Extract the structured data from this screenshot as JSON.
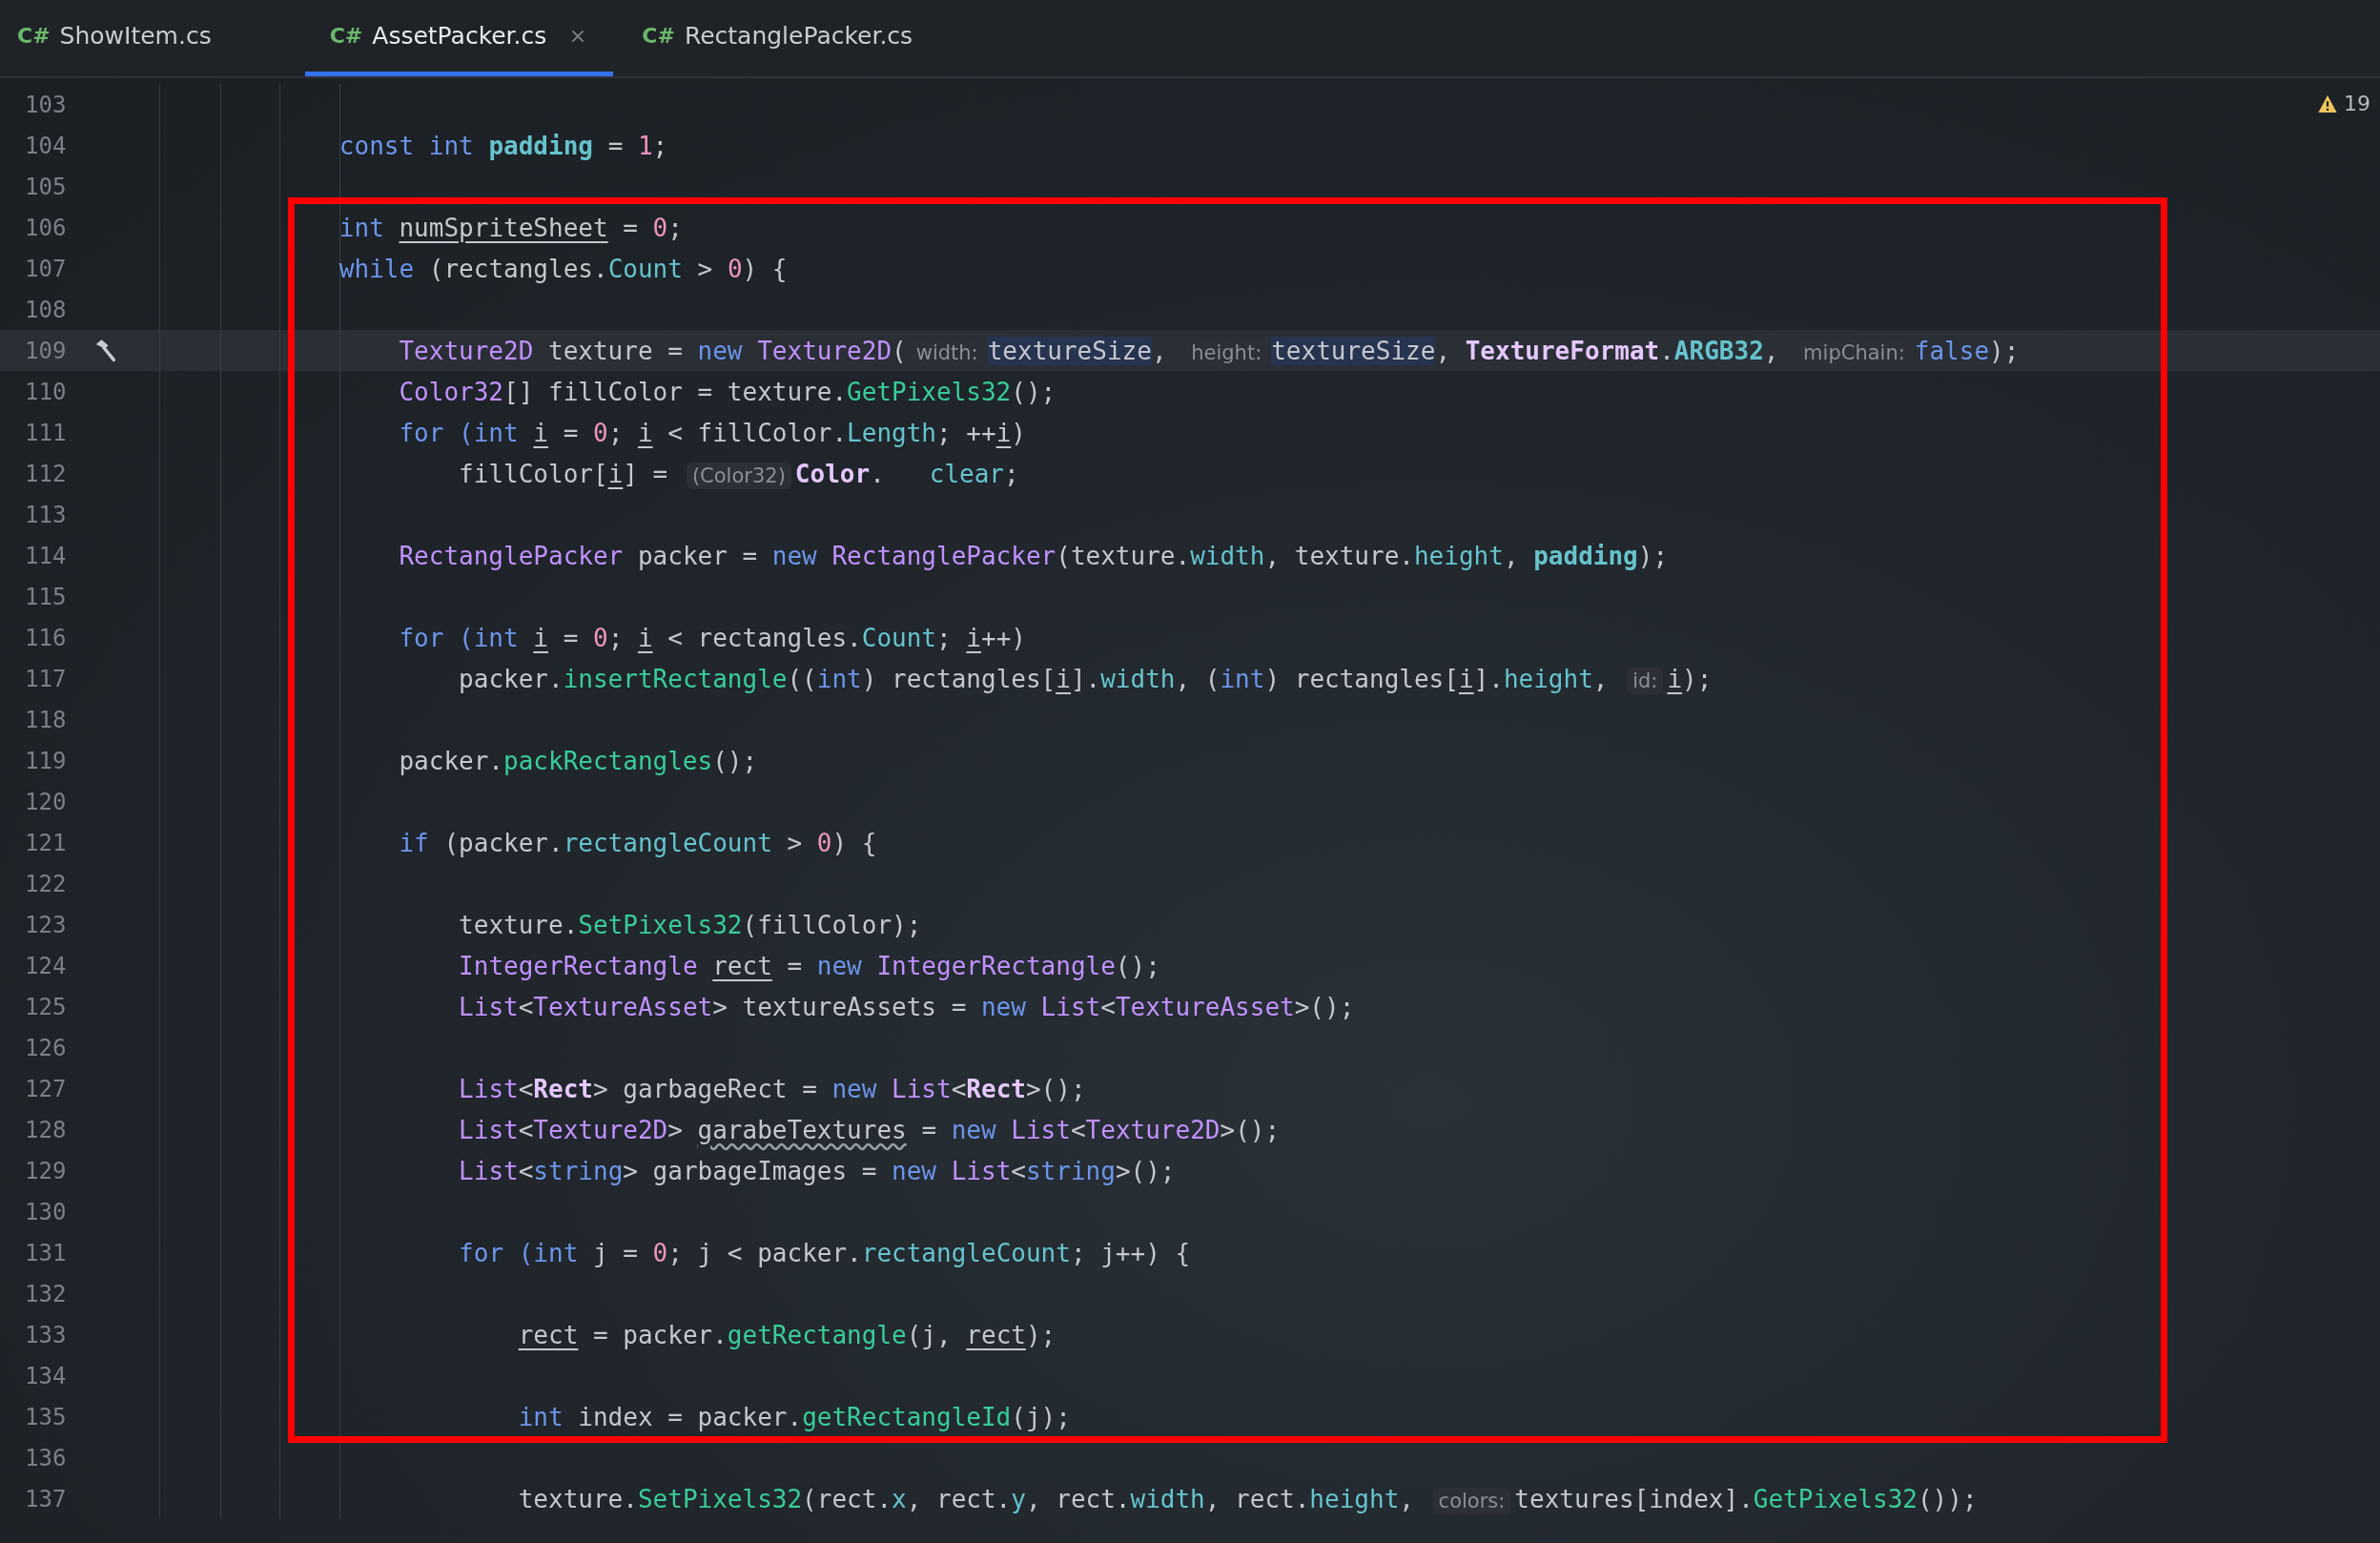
{
  "tabs": [
    {
      "lang": "C#",
      "label": "ShowItem.cs",
      "selected": false,
      "closable": false
    },
    {
      "lang": "C#",
      "label": "AssetPacker.cs",
      "selected": true,
      "closable": true
    },
    {
      "lang": "C#",
      "label": "RectanglePacker.cs",
      "selected": false,
      "closable": false
    }
  ],
  "warnings": {
    "count": "19"
  },
  "lines": [
    {
      "number": "103",
      "current": false
    },
    {
      "number": "104",
      "current": false,
      "tokens": [
        {
          "text": "            const int ",
          "kind": "keyword"
        },
        {
          "text": "padding",
          "kind": "const"
        },
        {
          "text": " = ",
          "kind": "plain"
        },
        {
          "text": "1",
          "kind": "number"
        },
        {
          "text": ";",
          "kind": "plain"
        }
      ]
    },
    {
      "number": "105",
      "current": false
    },
    {
      "number": "106",
      "current": false,
      "tokens": [
        {
          "text": "            int ",
          "kind": "keyword"
        },
        {
          "text": "numSpriteSheet",
          "kind": "local"
        },
        {
          "text": " = ",
          "kind": "plain"
        },
        {
          "text": "0",
          "kind": "number"
        },
        {
          "text": ";",
          "kind": "plain"
        }
      ]
    },
    {
      "number": "107",
      "current": false,
      "tokens": [
        {
          "text": "            while",
          "kind": "keyword"
        },
        {
          "text": " (rectangles.",
          "kind": "plain"
        },
        {
          "text": "Count",
          "kind": "field"
        },
        {
          "text": " > ",
          "kind": "plain"
        },
        {
          "text": "0",
          "kind": "number"
        },
        {
          "text": ") {",
          "kind": "plain"
        }
      ]
    },
    {
      "number": "108",
      "current": false
    },
    {
      "number": "109",
      "current": true,
      "gutter_icon": {
        "kind": "hammer"
      },
      "tokens": [
        {
          "text": "                Texture2D",
          "kind": "type"
        },
        {
          "text": " texture = ",
          "kind": "plain"
        },
        {
          "text": "new ",
          "kind": "keyword"
        },
        {
          "text": "Texture2D",
          "kind": "type"
        },
        {
          "text": "(",
          "kind": "plain"
        },
        {
          "text": "width:",
          "kind": "hint"
        },
        {
          "text": "textureSize",
          "kind": "match"
        },
        {
          "text": ", ",
          "kind": "plain"
        },
        {
          "text": "height:",
          "kind": "hint"
        },
        {
          "text": "textureSize",
          "kind": "match"
        },
        {
          "text": ", ",
          "kind": "plain"
        },
        {
          "text": "TextureFormat",
          "kind": "struct"
        },
        {
          "text": ".",
          "kind": "plain"
        },
        {
          "text": "ARGB32",
          "kind": "const"
        },
        {
          "text": ", ",
          "kind": "plain"
        },
        {
          "text": "mipChain:",
          "kind": "hint"
        },
        {
          "text": "false",
          "kind": "keyword"
        },
        {
          "text": ");",
          "kind": "plain"
        }
      ]
    },
    {
      "number": "110",
      "current": false,
      "tokens": [
        {
          "text": "                Color32",
          "kind": "type"
        },
        {
          "text": "[] fillColor = texture.",
          "kind": "plain"
        },
        {
          "text": "GetPixels32",
          "kind": "method"
        },
        {
          "text": "();",
          "kind": "plain"
        }
      ]
    },
    {
      "number": "111",
      "current": false,
      "tokens": [
        {
          "text": "                for (int ",
          "kind": "keyword"
        },
        {
          "text": "i",
          "kind": "local"
        },
        {
          "text": " = ",
          "kind": "plain"
        },
        {
          "text": "0",
          "kind": "number"
        },
        {
          "text": "; ",
          "kind": "plain"
        },
        {
          "text": "i",
          "kind": "local"
        },
        {
          "text": " < fillColor.",
          "kind": "plain"
        },
        {
          "text": "Length",
          "kind": "field"
        },
        {
          "text": "; ++",
          "kind": "plain"
        },
        {
          "text": "i",
          "kind": "local"
        },
        {
          "text": ")",
          "kind": "plain"
        }
      ]
    },
    {
      "number": "112",
      "current": false,
      "tokens": [
        {
          "text": "                    fillColor[",
          "kind": "plain"
        },
        {
          "text": "i",
          "kind": "local"
        },
        {
          "text": "] = ",
          "kind": "plain"
        },
        {
          "text": "(Color32)",
          "kind": "hint"
        },
        {
          "text": "Color",
          "kind": "struct"
        },
        {
          "text": ".   ",
          "kind": "plain"
        },
        {
          "text": "clear",
          "kind": "field"
        },
        {
          "text": ";",
          "kind": "plain"
        }
      ]
    },
    {
      "number": "113",
      "current": false
    },
    {
      "number": "114",
      "current": false,
      "tokens": [
        {
          "text": "                RectanglePacker",
          "kind": "type"
        },
        {
          "text": " packer = ",
          "kind": "plain"
        },
        {
          "text": "new ",
          "kind": "keyword"
        },
        {
          "text": "RectanglePacker",
          "kind": "type"
        },
        {
          "text": "(texture.",
          "kind": "plain"
        },
        {
          "text": "width",
          "kind": "field"
        },
        {
          "text": ", texture.",
          "kind": "plain"
        },
        {
          "text": "height",
          "kind": "field"
        },
        {
          "text": ", ",
          "kind": "plain"
        },
        {
          "text": "padding",
          "kind": "const"
        },
        {
          "text": ");",
          "kind": "plain"
        }
      ]
    },
    {
      "number": "115",
      "current": false
    },
    {
      "number": "116",
      "current": false,
      "tokens": [
        {
          "text": "                for (int ",
          "kind": "keyword"
        },
        {
          "text": "i",
          "kind": "local"
        },
        {
          "text": " = ",
          "kind": "plain"
        },
        {
          "text": "0",
          "kind": "number"
        },
        {
          "text": "; ",
          "kind": "plain"
        },
        {
          "text": "i",
          "kind": "local"
        },
        {
          "text": " < rectangles.",
          "kind": "plain"
        },
        {
          "text": "Count",
          "kind": "field"
        },
        {
          "text": "; ",
          "kind": "plain"
        },
        {
          "text": "i",
          "kind": "local"
        },
        {
          "text": "++)",
          "kind": "plain"
        }
      ]
    },
    {
      "number": "117",
      "current": false,
      "tokens": [
        {
          "text": "                    packer.",
          "kind": "plain"
        },
        {
          "text": "insertRectangle",
          "kind": "method"
        },
        {
          "text": "((",
          "kind": "plain"
        },
        {
          "text": "int",
          "kind": "keyword"
        },
        {
          "text": ") rectangles[",
          "kind": "plain"
        },
        {
          "text": "i",
          "kind": "local"
        },
        {
          "text": "].",
          "kind": "plain"
        },
        {
          "text": "width",
          "kind": "field"
        },
        {
          "text": ", (",
          "kind": "plain"
        },
        {
          "text": "int",
          "kind": "keyword"
        },
        {
          "text": ") rectangles[",
          "kind": "plain"
        },
        {
          "text": "i",
          "kind": "local"
        },
        {
          "text": "].",
          "kind": "plain"
        },
        {
          "text": "height",
          "kind": "field"
        },
        {
          "text": ", ",
          "kind": "plain"
        },
        {
          "text": "id:",
          "kind": "hint"
        },
        {
          "text": "i",
          "kind": "local"
        },
        {
          "text": ");",
          "kind": "plain"
        }
      ]
    },
    {
      "number": "118",
      "current": false
    },
    {
      "number": "119",
      "current": false,
      "tokens": [
        {
          "text": "                packer.",
          "kind": "plain"
        },
        {
          "text": "packRectangles",
          "kind": "method"
        },
        {
          "text": "();",
          "kind": "plain"
        }
      ]
    },
    {
      "number": "120",
      "current": false
    },
    {
      "number": "121",
      "current": false,
      "tokens": [
        {
          "text": "                if",
          "kind": "keyword"
        },
        {
          "text": " (packer.",
          "kind": "plain"
        },
        {
          "text": "rectangleCount",
          "kind": "field"
        },
        {
          "text": " > ",
          "kind": "plain"
        },
        {
          "text": "0",
          "kind": "number"
        },
        {
          "text": ") {",
          "kind": "plain"
        }
      ]
    },
    {
      "number": "122",
      "current": false
    },
    {
      "number": "123",
      "current": false,
      "tokens": [
        {
          "text": "                    texture.",
          "kind": "plain"
        },
        {
          "text": "SetPixels32",
          "kind": "method"
        },
        {
          "text": "(fillColor);",
          "kind": "plain"
        }
      ]
    },
    {
      "number": "124",
      "current": false,
      "tokens": [
        {
          "text": "                    IntegerRectangle ",
          "kind": "type"
        },
        {
          "text": "rect",
          "kind": "local"
        },
        {
          "text": " = ",
          "kind": "plain"
        },
        {
          "text": "new ",
          "kind": "keyword"
        },
        {
          "text": "IntegerRectangle",
          "kind": "type"
        },
        {
          "text": "();",
          "kind": "plain"
        }
      ]
    },
    {
      "number": "125",
      "current": false,
      "tokens": [
        {
          "text": "                    List",
          "kind": "type"
        },
        {
          "text": "<",
          "kind": "plain"
        },
        {
          "text": "TextureAsset",
          "kind": "type"
        },
        {
          "text": "> textureAssets = ",
          "kind": "plain"
        },
        {
          "text": "new ",
          "kind": "keyword"
        },
        {
          "text": "List",
          "kind": "type"
        },
        {
          "text": "<",
          "kind": "plain"
        },
        {
          "text": "TextureAsset",
          "kind": "type"
        },
        {
          "text": ">();",
          "kind": "plain"
        }
      ]
    },
    {
      "number": "126",
      "current": false
    },
    {
      "number": "127",
      "current": false,
      "tokens": [
        {
          "text": "                    List",
          "kind": "type"
        },
        {
          "text": "<",
          "kind": "plain"
        },
        {
          "text": "Rect",
          "kind": "struct"
        },
        {
          "text": "> garbageRect = ",
          "kind": "plain"
        },
        {
          "text": "new ",
          "kind": "keyword"
        },
        {
          "text": "List",
          "kind": "type"
        },
        {
          "text": "<",
          "kind": "plain"
        },
        {
          "text": "Rect",
          "kind": "struct"
        },
        {
          "text": ">();",
          "kind": "plain"
        }
      ]
    },
    {
      "number": "128",
      "current": false,
      "tokens": [
        {
          "text": "                    List",
          "kind": "type"
        },
        {
          "text": "<",
          "kind": "plain"
        },
        {
          "text": "Texture2D",
          "kind": "type"
        },
        {
          "text": "> ",
          "kind": "plain"
        },
        {
          "text": "garabeTextures",
          "kind": "typo"
        },
        {
          "text": " = ",
          "kind": "plain"
        },
        {
          "text": "new ",
          "kind": "keyword"
        },
        {
          "text": "List",
          "kind": "type"
        },
        {
          "text": "<",
          "kind": "plain"
        },
        {
          "text": "Texture2D",
          "kind": "type"
        },
        {
          "text": ">();",
          "kind": "plain"
        }
      ]
    },
    {
      "number": "129",
      "current": false,
      "tokens": [
        {
          "text": "                    List",
          "kind": "type"
        },
        {
          "text": "<",
          "kind": "plain"
        },
        {
          "text": "string",
          "kind": "keyword"
        },
        {
          "text": "> garbageImages = ",
          "kind": "plain"
        },
        {
          "text": "new ",
          "kind": "keyword"
        },
        {
          "text": "List",
          "kind": "type"
        },
        {
          "text": "<",
          "kind": "plain"
        },
        {
          "text": "string",
          "kind": "keyword"
        },
        {
          "text": ">();",
          "kind": "plain"
        }
      ]
    },
    {
      "number": "130",
      "current": false
    },
    {
      "number": "131",
      "current": false,
      "tokens": [
        {
          "text": "                    for (int",
          "kind": "keyword"
        },
        {
          "text": " j = ",
          "kind": "plain"
        },
        {
          "text": "0",
          "kind": "number"
        },
        {
          "text": "; j < packer.",
          "kind": "plain"
        },
        {
          "text": "rectangleCount",
          "kind": "field"
        },
        {
          "text": "; j++) {",
          "kind": "plain"
        }
      ]
    },
    {
      "number": "132",
      "current": false
    },
    {
      "number": "133",
      "current": false,
      "tokens": [
        {
          "text": "                        rect",
          "kind": "local"
        },
        {
          "text": " = packer.",
          "kind": "plain"
        },
        {
          "text": "getRectangle",
          "kind": "method"
        },
        {
          "text": "(j, ",
          "kind": "plain"
        },
        {
          "text": "rect",
          "kind": "local"
        },
        {
          "text": ");",
          "kind": "plain"
        }
      ]
    },
    {
      "number": "134",
      "current": false
    },
    {
      "number": "135",
      "current": false,
      "tokens": [
        {
          "text": "                        int",
          "kind": "keyword"
        },
        {
          "text": " index = packer.",
          "kind": "plain"
        },
        {
          "text": "getRectangleId",
          "kind": "method"
        },
        {
          "text": "(j);",
          "kind": "plain"
        }
      ]
    },
    {
      "number": "136",
      "current": false
    },
    {
      "number": "137",
      "current": false,
      "tokens": [
        {
          "text": "                        texture.",
          "kind": "plain"
        },
        {
          "text": "SetPixels32",
          "kind": "method"
        },
        {
          "text": "(rect.",
          "kind": "plain"
        },
        {
          "text": "x",
          "kind": "field"
        },
        {
          "text": ", rect.",
          "kind": "plain"
        },
        {
          "text": "y",
          "kind": "field"
        },
        {
          "text": ", rect.",
          "kind": "plain"
        },
        {
          "text": "width",
          "kind": "field"
        },
        {
          "text": ", rect.",
          "kind": "plain"
        },
        {
          "text": "height",
          "kind": "field"
        },
        {
          "text": ", ",
          "kind": "plain"
        },
        {
          "text": "colors:",
          "kind": "hint"
        },
        {
          "text": "textures[index].",
          "kind": "plain"
        },
        {
          "text": "GetPixels32",
          "kind": "method"
        },
        {
          "text": "());",
          "kind": "plain"
        }
      ]
    }
  ]
}
